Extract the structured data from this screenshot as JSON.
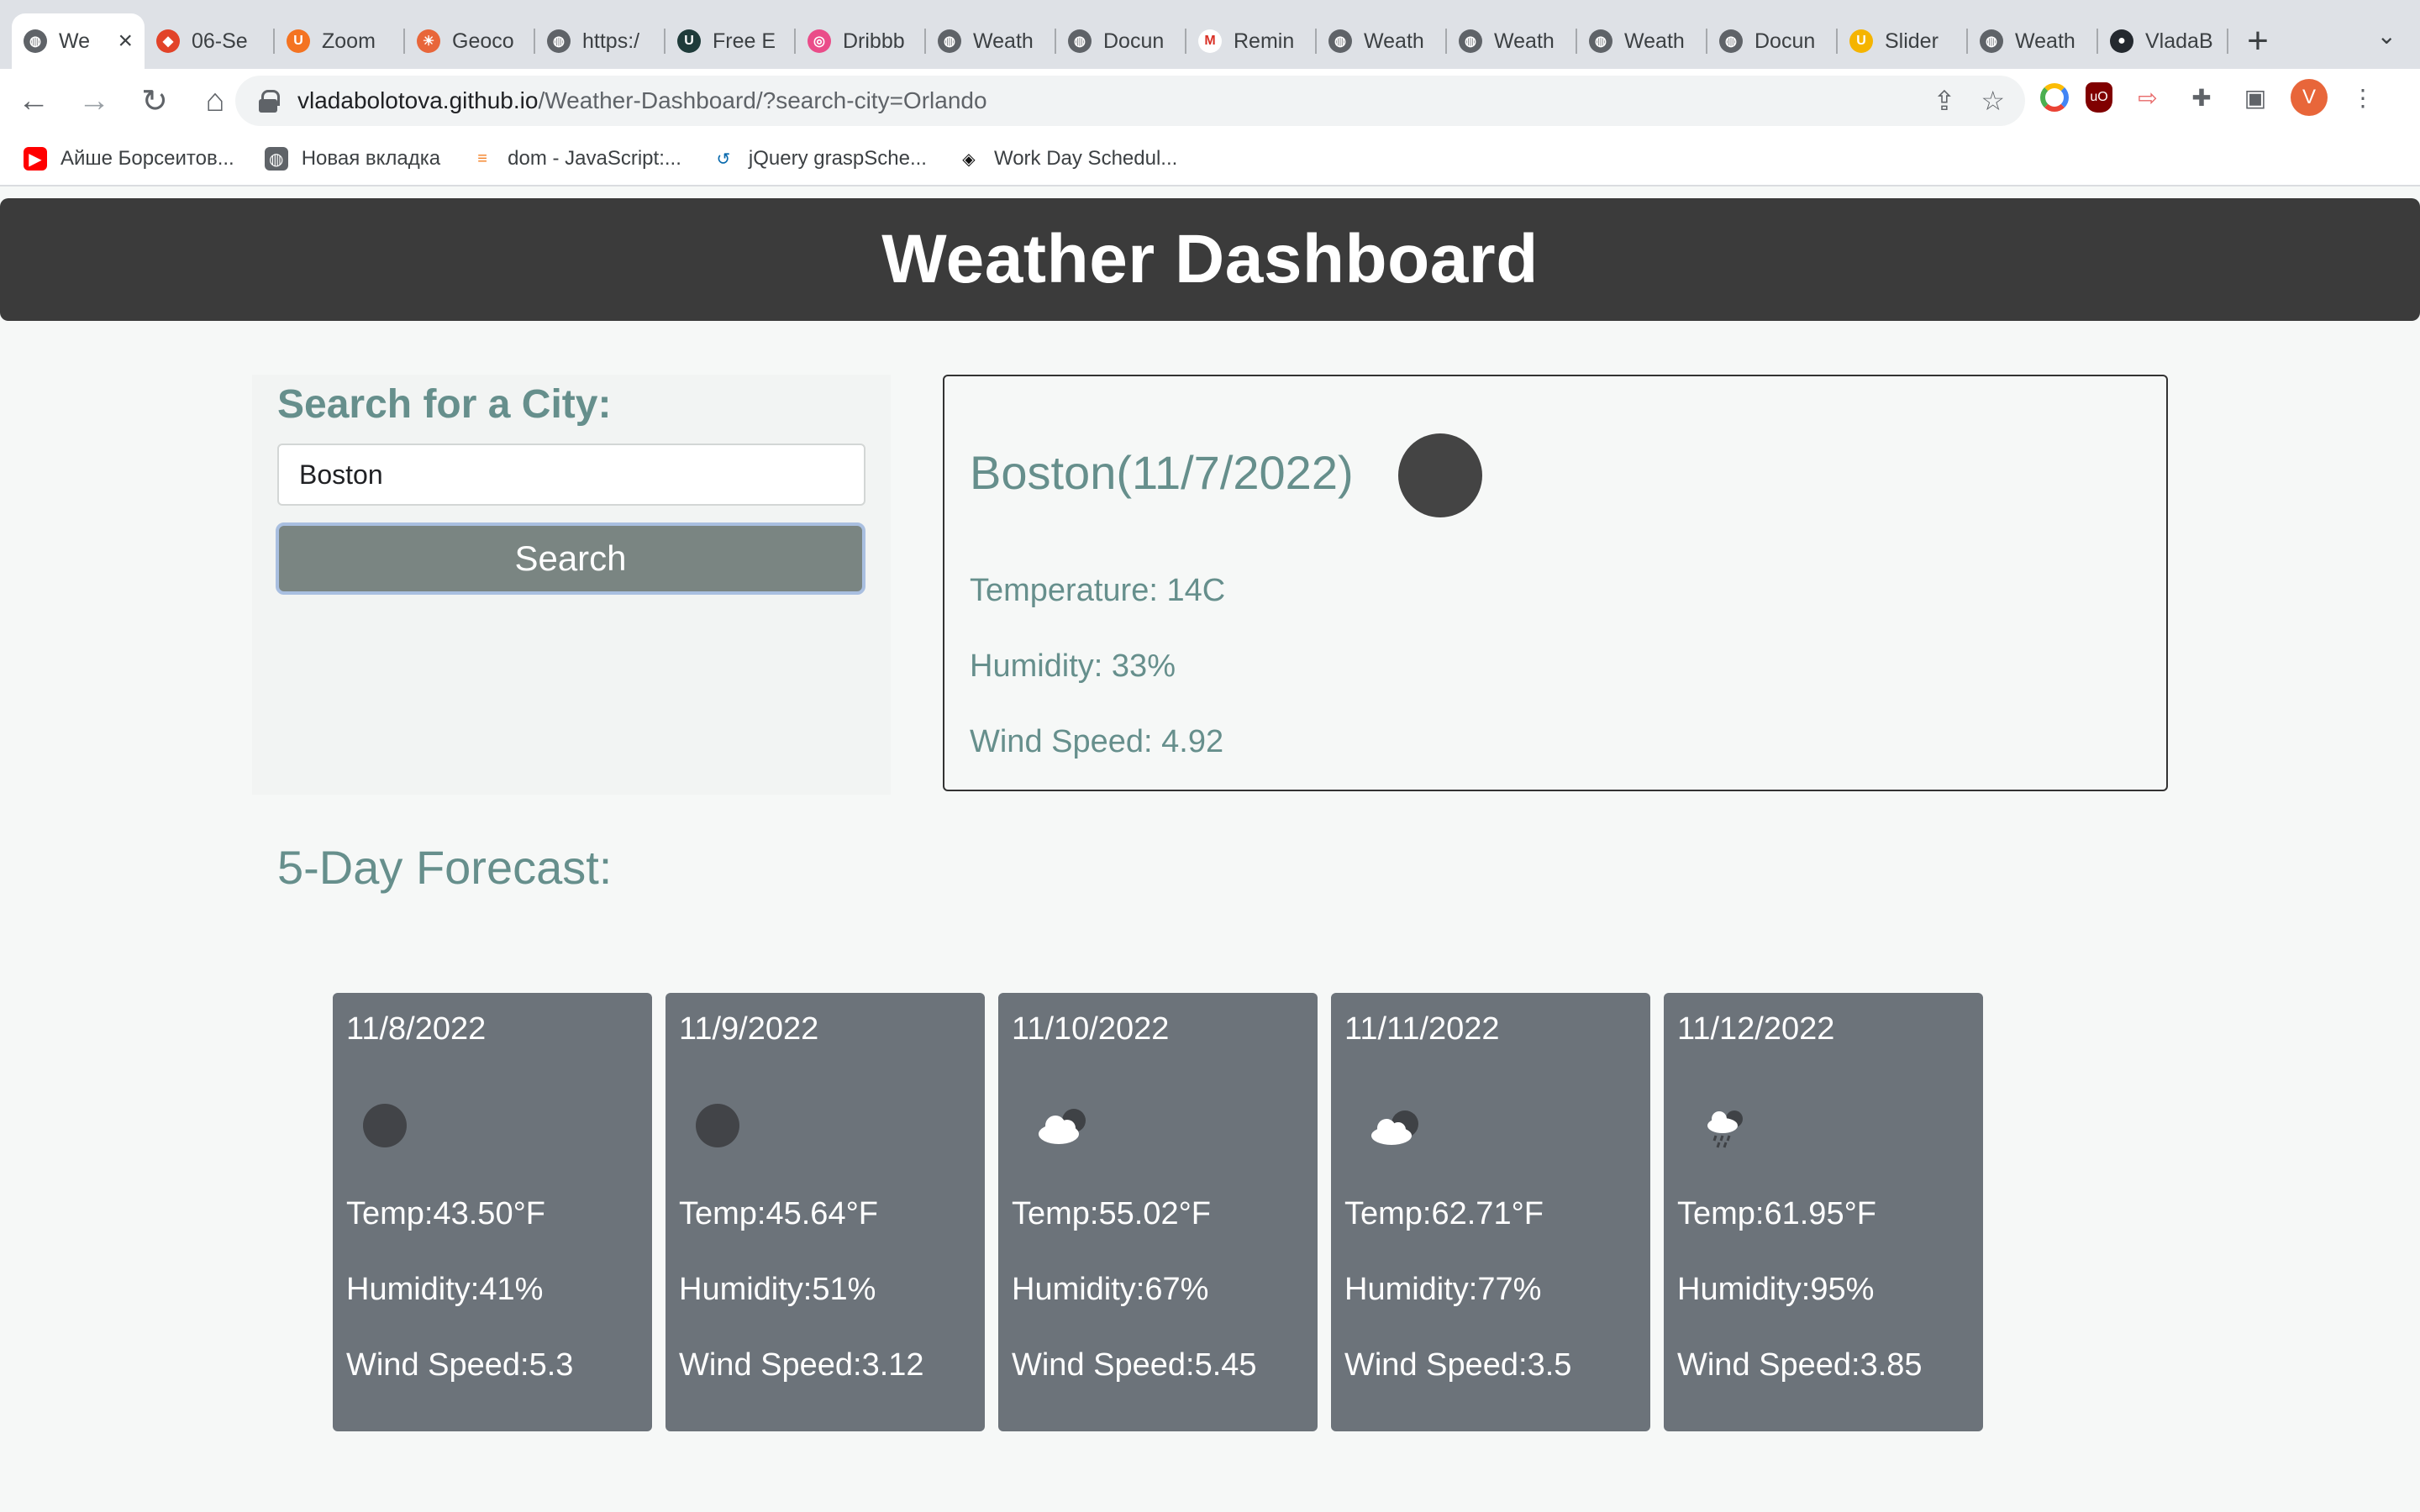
{
  "browser": {
    "tabs": [
      {
        "title": "We",
        "icon": "globe-icon",
        "active": true
      },
      {
        "title": "06-Se",
        "icon": "gitlab-icon"
      },
      {
        "title": "Zoom",
        "icon": "university-u-icon"
      },
      {
        "title": "Geoco",
        "icon": "weather-sun-icon"
      },
      {
        "title": "https:/",
        "icon": "globe-icon"
      },
      {
        "title": "Free E",
        "icon": "u-logo-icon"
      },
      {
        "title": "Dribbb",
        "icon": "dribbble-icon"
      },
      {
        "title": "Weath",
        "icon": "globe-icon"
      },
      {
        "title": "Docun",
        "icon": "globe-icon"
      },
      {
        "title": "Remin",
        "icon": "gmail-icon"
      },
      {
        "title": "Weath",
        "icon": "globe-icon"
      },
      {
        "title": "Weath",
        "icon": "globe-icon"
      },
      {
        "title": "Weath",
        "icon": "globe-icon"
      },
      {
        "title": "Docun",
        "icon": "globe-icon"
      },
      {
        "title": "Slider",
        "icon": "shield-u-icon"
      },
      {
        "title": "Weath",
        "icon": "globe-icon"
      },
      {
        "title": "VladaB",
        "icon": "github-icon"
      }
    ],
    "url_host": "vladabolotova.github.io",
    "url_path": "/Weather-Dashboard/?search-city=Orlando",
    "profile_initial": "V",
    "bookmarks": [
      {
        "label": "Айше Борсеитов...",
        "icon": "youtube-icon"
      },
      {
        "label": "Новая вкладка",
        "icon": "globe-icon"
      },
      {
        "label": "dom - JavaScript:...",
        "icon": "stackoverflow-icon"
      },
      {
        "label": "jQuery graspSche...",
        "icon": "jquery-icon"
      },
      {
        "label": "Work Day Schedul...",
        "icon": "codepen-icon"
      }
    ]
  },
  "page": {
    "title": "Weather Dashboard",
    "search": {
      "label": "Search for a City:",
      "value": "Boston",
      "button": "Search"
    },
    "current": {
      "heading": "Boston(11/7/2022)",
      "icon": "moon-icon",
      "temperature": "Temperature: 14C",
      "humidity": "Humidity: 33%",
      "wind": "Wind Speed: 4.92"
    },
    "forecast_title": "5-Day Forecast:",
    "forecast": [
      {
        "date": "11/8/2022",
        "icon": "moon-icon",
        "temp": "Temp:43.50°F",
        "humidity": "Humidity:41%",
        "wind": "Wind Speed:5.3"
      },
      {
        "date": "11/9/2022",
        "icon": "moon-icon",
        "temp": "Temp:45.64°F",
        "humidity": "Humidity:51%",
        "wind": "Wind Speed:3.12"
      },
      {
        "date": "11/10/2022",
        "icon": "cloud-moon-icon",
        "temp": "Temp:55.02°F",
        "humidity": "Humidity:67%",
        "wind": "Wind Speed:5.45"
      },
      {
        "date": "11/11/2022",
        "icon": "cloud-moon-icon",
        "temp": "Temp:62.71°F",
        "humidity": "Humidity:77%",
        "wind": "Wind Speed:3.5"
      },
      {
        "date": "11/12/2022",
        "icon": "rain-cloud-icon",
        "temp": "Temp:61.95°F",
        "humidity": "Humidity:95%",
        "wind": "Wind Speed:3.85"
      }
    ]
  },
  "colors": {
    "header_bg": "#3b3b3b",
    "accent_text": "#668f8c",
    "card_bg": "#6c737a",
    "button_bg": "#7a8582"
  }
}
